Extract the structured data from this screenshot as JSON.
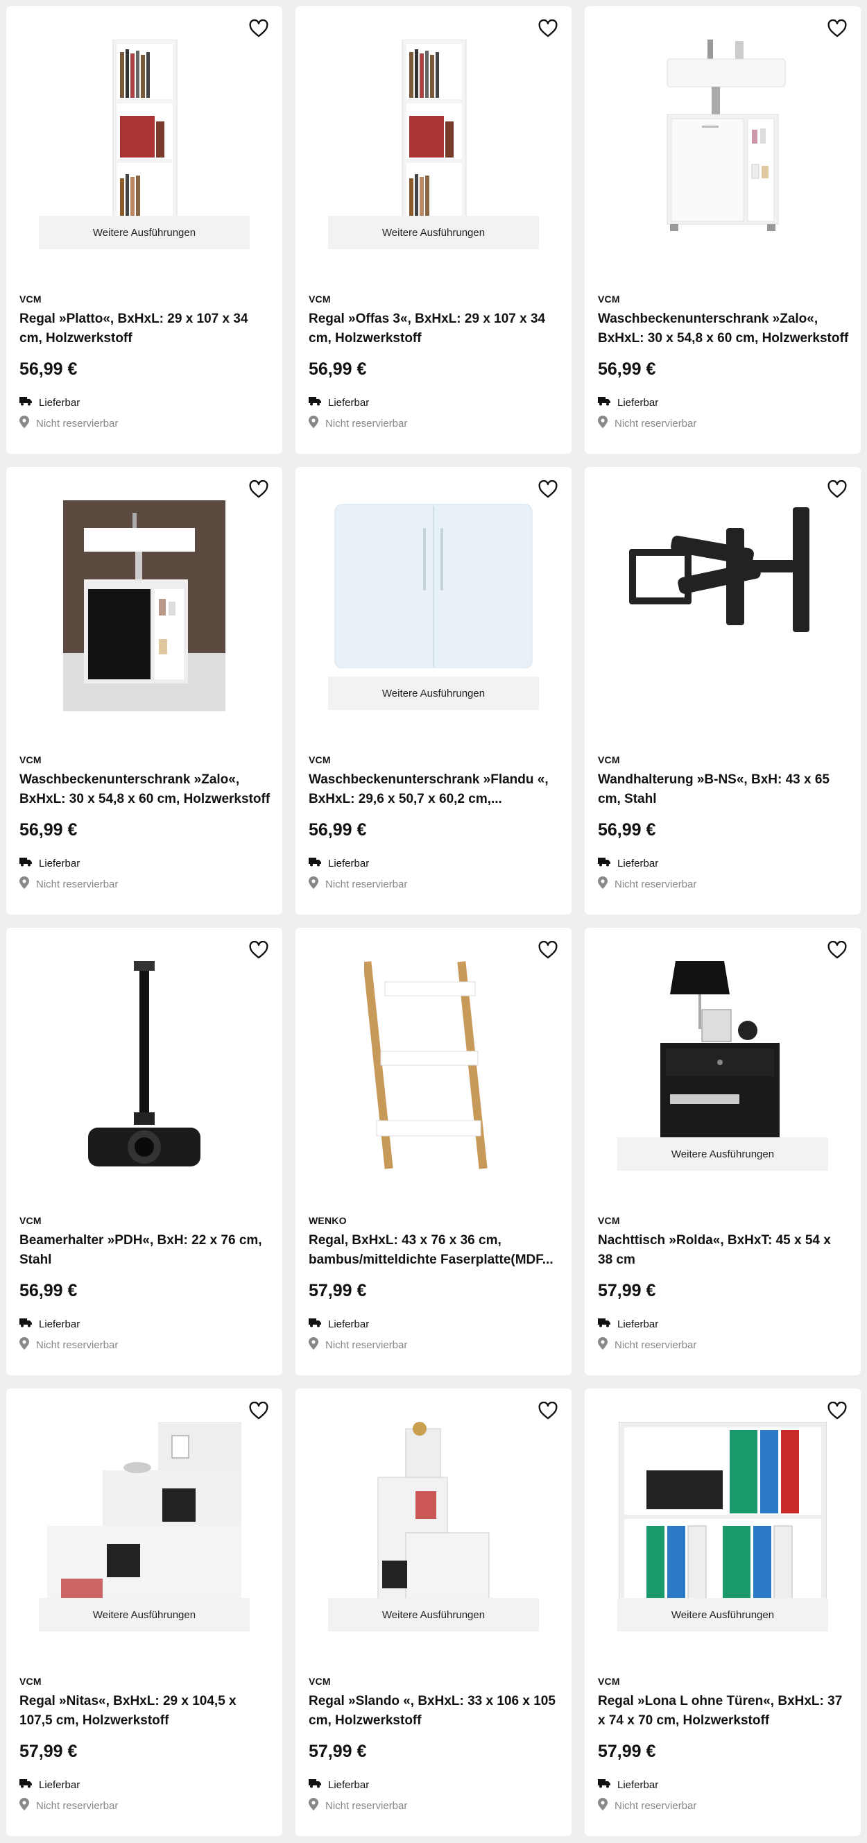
{
  "ui": {
    "variants_label": "Weitere Ausführungen",
    "delivery_label": "Lieferbar",
    "reserve_label": "Nicht reservierbar"
  },
  "products": [
    {
      "brand": "VCM",
      "title": "Regal »Platto«, BxHxL: 29 x 107 x 34 cm, Holzwerkstoff",
      "price": "56,99 €",
      "variants": true,
      "image": "tall-shelf"
    },
    {
      "brand": "VCM",
      "title": "Regal »Offas 3«, BxHxL: 29 x 107 x 34 cm, Holzwerkstoff",
      "price": "56,99 €",
      "variants": true,
      "image": "tall-shelf"
    },
    {
      "brand": "VCM",
      "title": "Waschbeckenunterschrank »Zalo«, BxHxL: 30 x 54,8 x 60 cm, Holzwerkstoff",
      "price": "56,99 €",
      "variants": false,
      "image": "sink-cabinet-white"
    },
    {
      "brand": "VCM",
      "title": "Waschbeckenunterschrank »Zalo«, BxHxL: 30 x 54,8 x 60 cm, Holzwerkstoff",
      "price": "56,99 €",
      "variants": false,
      "image": "sink-cabinet-black"
    },
    {
      "brand": "VCM",
      "title": "Waschbeckenunterschrank »Flandu «, BxHxL: 29,6 x 50,7 x 60,2 cm,...",
      "price": "56,99 €",
      "variants": true,
      "image": "white-cabinet"
    },
    {
      "brand": "VCM",
      "title": "Wandhalterung »B-NS«, BxH: 43 x 65 cm, Stahl",
      "price": "56,99 €",
      "variants": false,
      "image": "tv-mount"
    },
    {
      "brand": "VCM",
      "title": "Beamerhalter »PDH«, BxH: 22 x 76 cm, Stahl",
      "price": "56,99 €",
      "variants": false,
      "image": "projector-mount"
    },
    {
      "brand": "WENKO",
      "title": "Regal, BxHxL: 43 x 76 x 36 cm, bambus/mitteldichte Faserplatte(MDF...",
      "price": "57,99 €",
      "variants": false,
      "image": "ladder-shelf"
    },
    {
      "brand": "VCM",
      "title": "Nachttisch »Rolda«, BxHxT: 45 x 54 x 38 cm",
      "price": "57,99 €",
      "variants": true,
      "image": "nightstand"
    },
    {
      "brand": "VCM",
      "title": "Regal »Nitas«, BxHxL: 29 x 104,5 x 107,5 cm, Holzwerkstoff",
      "price": "57,99 €",
      "variants": true,
      "image": "step-shelf"
    },
    {
      "brand": "VCM",
      "title": "Regal »Slando «, BxHxL: 33 x 106 x 105 cm, Holzwerkstoff",
      "price": "57,99 €",
      "variants": true,
      "image": "step-shelf-2"
    },
    {
      "brand": "VCM",
      "title": "Regal »Lona L ohne Türen«, BxHxL: 37 x 74 x 70 cm, Holzwerkstoff",
      "price": "57,99 €",
      "variants": true,
      "image": "binder-shelf"
    }
  ]
}
